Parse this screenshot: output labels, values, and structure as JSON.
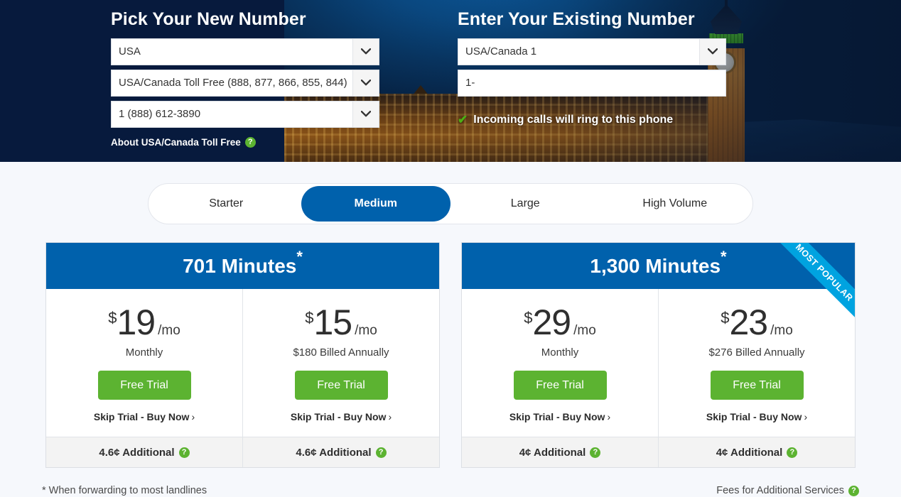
{
  "hero": {
    "new_number": {
      "title": "Pick Your New Number",
      "country": "USA",
      "type": "USA/Canada Toll Free (888, 877, 866, 855, 844)",
      "number": "1 (888) 612-3890",
      "about_label": "About USA/Canada Toll Free",
      "about_help_icon": "help-icon"
    },
    "existing_number": {
      "title": "Enter Your Existing Number",
      "country": "USA/Canada 1",
      "number_placeholder": "1-",
      "number_value": "1-",
      "note": "Incoming calls will ring to this phone",
      "note_icon": "check-icon"
    },
    "dropdown_icon": "chevron-down-icon"
  },
  "tabs": [
    {
      "label": "Starter",
      "active": false
    },
    {
      "label": "Medium",
      "active": true
    },
    {
      "label": "Large",
      "active": false
    },
    {
      "label": "High Volume",
      "active": false
    }
  ],
  "cards": [
    {
      "minutes": "701 Minutes",
      "asterisk": "*",
      "ribbon": null,
      "plans": [
        {
          "currency": "$",
          "amount": "19",
          "per": "/mo",
          "billing": "Monthly",
          "cta": "Free Trial",
          "skip": "Skip Trial - Buy Now",
          "chevron": "›",
          "additional": "4.6¢ Additional",
          "additional_help_icon": "help-icon"
        },
        {
          "currency": "$",
          "amount": "15",
          "per": "/mo",
          "billing": "$180 Billed Annually",
          "cta": "Free Trial",
          "skip": "Skip Trial - Buy Now",
          "chevron": "›",
          "additional": "4.6¢ Additional",
          "additional_help_icon": "help-icon"
        }
      ]
    },
    {
      "minutes": "1,300 Minutes",
      "asterisk": "*",
      "ribbon": "MOST POPULAR",
      "plans": [
        {
          "currency": "$",
          "amount": "29",
          "per": "/mo",
          "billing": "Monthly",
          "cta": "Free Trial",
          "skip": "Skip Trial - Buy Now",
          "chevron": "›",
          "additional": "4¢ Additional",
          "additional_help_icon": "help-icon"
        },
        {
          "currency": "$",
          "amount": "23",
          "per": "/mo",
          "billing": "$276 Billed Annually",
          "cta": "Free Trial",
          "skip": "Skip Trial - Buy Now",
          "chevron": "›",
          "additional": "4¢ Additional",
          "additional_help_icon": "help-icon"
        }
      ]
    }
  ],
  "footer": {
    "note": "* When forwarding to most landlines",
    "fees_label": "Fees for Additional Services",
    "fees_help_icon": "help-icon"
  },
  "colors": {
    "hero_navy": "#071a3d",
    "brand_blue": "#0061ac",
    "ribbon_blue": "#00a3e0",
    "cta_green": "#5cb331",
    "help_green": "#5cb331",
    "check_green": "#4caf14",
    "page_bg": "#f6f8fc"
  }
}
